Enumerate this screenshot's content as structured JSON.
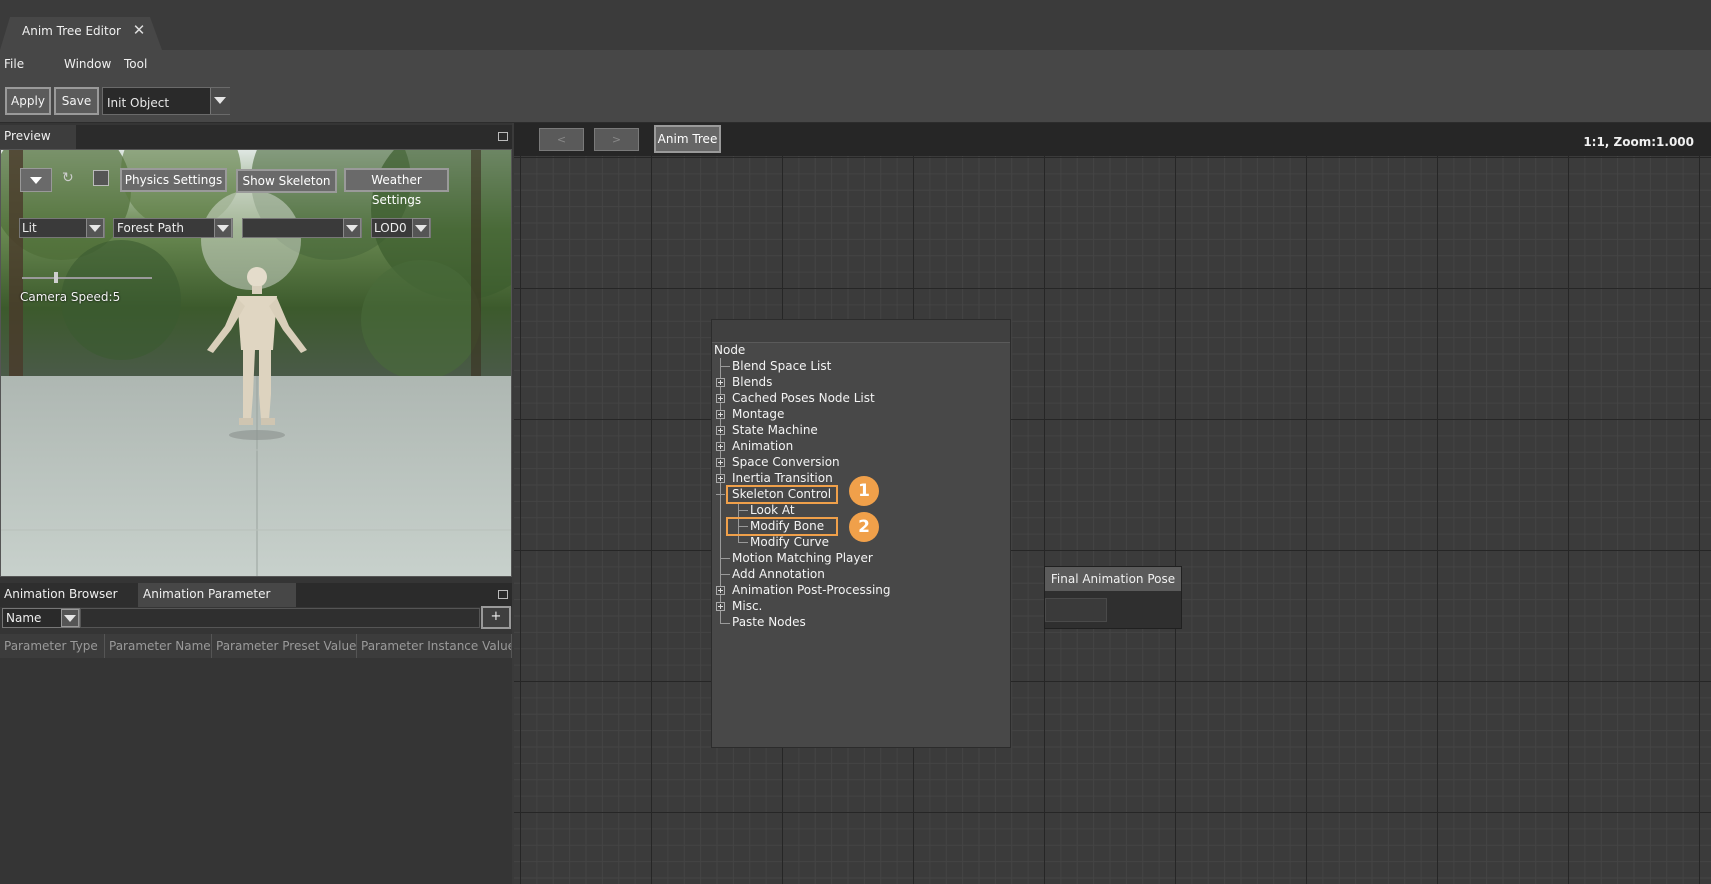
{
  "tabbar": {
    "tab_label": "Anim Tree Editor",
    "close_icon": "close-icon"
  },
  "menubar": {
    "items": [
      "File",
      "Window",
      "Tool"
    ]
  },
  "toolbar": {
    "apply_label": "Apply",
    "save_label": "Save",
    "object_select_value": "Init Object"
  },
  "preview": {
    "title": "Preview",
    "buttons": {
      "physics": "Physics Settings",
      "skeleton": "Show Skeleton",
      "weather": "Weather Settings"
    },
    "selects": {
      "lighting": "Lit",
      "environment": "Forest Path",
      "third": "",
      "lod": "LOD0"
    },
    "camera_speed": "Camera Speed:5"
  },
  "bottom_panel": {
    "tabs": [
      "Animation Browser",
      "Animation Parameter"
    ],
    "filter_select": "Name",
    "add_label": "+",
    "columns": [
      "Parameter Type",
      "Parameter Name",
      "Parameter Preset Value",
      "Parameter Instance Value"
    ]
  },
  "graph": {
    "nav_back": "<",
    "nav_forward": ">",
    "breadcrumb": "Anim Tree",
    "zoom_text": "1:1, Zoom:1.000"
  },
  "node_menu": {
    "root": "Node",
    "items": {
      "blend_space_list": "Blend Space List",
      "blends": "Blends",
      "cached_poses": "Cached Poses Node List",
      "montage": "Montage",
      "state_machine": "State Machine",
      "animation": "Animation",
      "space_conversion": "Space Conversion",
      "inertia_transition": "Inertia Transition",
      "skeleton_control": "Skeleton Control",
      "look_at": "Look At",
      "modify_bone": "Modify Bone",
      "modify_curve": "Modify Curve",
      "motion_matching": "Motion Matching Player",
      "add_annotation": "Add Annotation",
      "post_processing": "Animation Post-Processing",
      "misc": "Misc.",
      "paste_nodes": "Paste Nodes"
    },
    "badges": [
      "1",
      "2"
    ],
    "highlight_color": "#f0a04a"
  },
  "final_node": {
    "title": "Final Animation Pose"
  }
}
